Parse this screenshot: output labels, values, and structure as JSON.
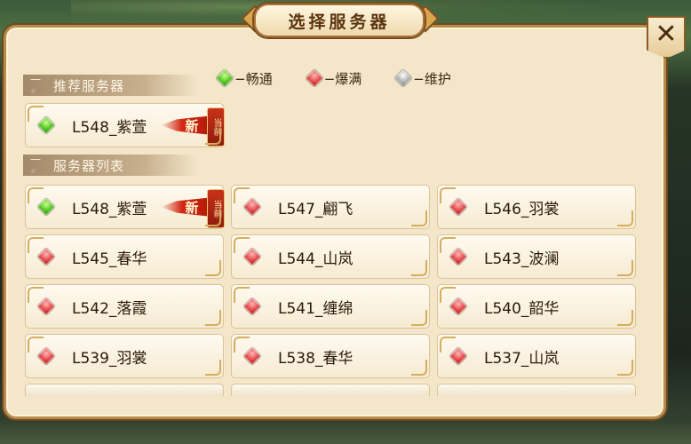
{
  "title": "选择服务器",
  "close_icon": "✕",
  "legend": [
    {
      "status": "green",
      "label": "−畅通"
    },
    {
      "status": "red",
      "label": "−爆满"
    },
    {
      "status": "gray",
      "label": "−维护"
    }
  ],
  "sections": {
    "recommended": "推荐服务器",
    "list": "服务器列表"
  },
  "recommended_server": {
    "name": "L548_紫萱",
    "status": "green",
    "new_badge": "新",
    "current_badge": "当前"
  },
  "servers": [
    {
      "name": "L548_紫萱",
      "status": "green",
      "new_badge": "新",
      "current_badge": "当前"
    },
    {
      "name": "L547_翩飞",
      "status": "red"
    },
    {
      "name": "L546_羽裳",
      "status": "red"
    },
    {
      "name": "L545_春华",
      "status": "red"
    },
    {
      "name": "L544_山岚",
      "status": "red"
    },
    {
      "name": "L543_波澜",
      "status": "red"
    },
    {
      "name": "L542_落霞",
      "status": "red"
    },
    {
      "name": "L541_缠绵",
      "status": "red"
    },
    {
      "name": "L540_韶华",
      "status": "red"
    },
    {
      "name": "L539_羽裳",
      "status": "red"
    },
    {
      "name": "L538_春华",
      "status": "red"
    },
    {
      "name": "L537_山岚",
      "status": "red"
    }
  ],
  "colors": {
    "panel": "#f3e6c9",
    "frame": "#b98a4a",
    "new_badge": "#d22814"
  }
}
